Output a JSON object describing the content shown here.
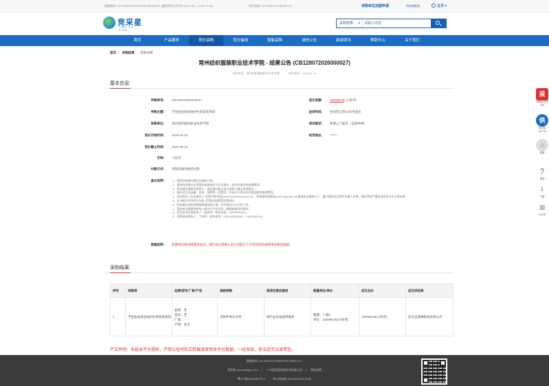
{
  "topbar": {
    "service_hotline": "客服热线: 020-89922379/89922307/80922371 (服务时间工作日8:30-12:00，14:00-17:30)",
    "complaint_hotline": "投诉热线: 020-89922377/80922713",
    "hot_apply": "采购单位加盟申请",
    "supplier_login": "供应商登录",
    "login": "登录"
  },
  "logo": {
    "name": "竞采星",
    "sub": "JING CAI XING"
  },
  "search": {
    "category": "采购结果",
    "placeholder": "请输入内容",
    "icon": "search-icon"
  },
  "nav": {
    "items": [
      "首页",
      "产品服务",
      "竞价采购",
      "竞价操场",
      "智能采购",
      "诚信公告",
      "新闻资讯",
      "帮助中心",
      "关于我们"
    ],
    "active_index": 2
  },
  "breadcrumb": [
    "首页",
    "采购结果",
    "结果详情"
  ],
  "announcement": {
    "title": "常州纺织服装职业技术学院 - 结果公告 (CB128072026000027)",
    "publisher": "发布单位：常州纺织服装职业技术学院",
    "publish_time": "发布时间：2026-06-14"
  },
  "basic": {
    "section_title": "基本信息:",
    "fields": {
      "purchase_no": {
        "label": "申购单号：",
        "value": "CB128072026000027"
      },
      "amount": {
        "label": "成交金额：",
        "value": "100098.00",
        "unit": "(人民币)"
      },
      "subject": {
        "label": "申购主题：",
        "value": "学生宿舍阳台防护栏及安装项目"
      },
      "delivery": {
        "label": "送货时间：",
        "value": "合同签订后15天内送达"
      },
      "unit": {
        "label": "采购单位：",
        "value": "常州纺织服装职业技术学院"
      },
      "requirement": {
        "label": "项目要求：",
        "value": "免费上门安装（含附件费）"
      },
      "start_time": {
        "label": "竞价开始时间：",
        "value": "2026-06-05"
      },
      "receipt_addr": {
        "label": "收货地址：",
        "value": "******"
      },
      "end_time": {
        "label": "竞价截止时间：",
        "value": "2026-06-13"
      },
      "currency": {
        "label": "币种：",
        "value": "人民币"
      },
      "payment": {
        "label": "付款方式：",
        "value": "项目验收合格后付款"
      },
      "notes_label": "备注说明：",
      "notes": [
        "1、请供应商按时报价及接收订单。",
        "2、请供应商报价必须提供安装报价与产品报价，提交时请注明安装费用。",
        "3、如有疑问请联系采购人，请在报价截止前与采购人确认现场情况。",
        "4、报价应包含运输、安装、税费等一切费用，中标后不得以任何理由要求增加费用。",
        "4、供应商近三年未被列入\"信用中国\"网站(www.creditchina.gov.cn)、中国政府采购网(www.ccgp.gov.cn)渠道失信被执行人、重大税收违法案件当事人名单、政府采购严重违法失信行为记录名单。",
        "5、在\"响应文件附件\"内请上传营业执照等证明材料。",
        "6、所有报价材料如需盖章请加盖公章，并扫描为PDF文件上传。",
        "7、投标单位需提供联系人姓名与手机号码，确保能够及时联系。",
        "8、项目技术负责联系人：赵老师，联系电话：13915890337。",
        "9、采购经办联系人：丁老师，联系电话：0519-86336003，13813663134。"
      ],
      "question_label": "质疑说明：",
      "question_value": "如果供应商对结果有异议，请在竞价结果公示之日起三个工作日内向采购单位提出质疑。"
    }
  },
  "result": {
    "section_title": "采购结果:",
    "headers": [
      "序号",
      "采购项",
      "品牌/型号/厂家/产地",
      "规格参数",
      "质保及售后服务",
      "数量单位/单价",
      "成交总价",
      "成交供应商"
    ],
    "rows": [
      {
        "no": "1",
        "item": "学生宿舍阳台防护栏采购及安装",
        "brand_lines": [
          "品牌：无",
          "型号：无",
          "厂家：",
          "产地：武汉"
        ],
        "spec": "见附件询价文件",
        "service": "按行业标准提供服务",
        "qty_lines": [
          "数量：1 (批)",
          "单价：100098.00(人民币)"
        ],
        "total": "100098.00(人民币)",
        "supplier": "武汉全晟琳家具有限公司"
      }
    ]
  },
  "notice": "严正声明：未经本平台授权，严禁以任何形式转载或使用本平台数据，一经发现，依法追究法律责任。",
  "footer": {
    "line1": "客服热线: 020-89922379/89922307/80922371",
    "line2": [
      "竞采星 www.easyjcx.com",
      "广州竞采星信息技术有限公司",
      "隐私政策"
    ],
    "line3": [
      "粤ICP备18058887号-2",
      "粤公网安备 44010502001348号"
    ]
  },
  "sidebar": [
    {
      "glyph": "采",
      "label": "采购商合作",
      "count": "398"
    },
    {
      "glyph": "供",
      "label": "供应商",
      "count": "181754"
    },
    {
      "glyph": "",
      "label": "客服"
    },
    {
      "glyph": "?",
      "label": "帮助"
    },
    {
      "glyph": "",
      "label": "下载"
    },
    {
      "glyph": "",
      "label": "公众号"
    }
  ]
}
